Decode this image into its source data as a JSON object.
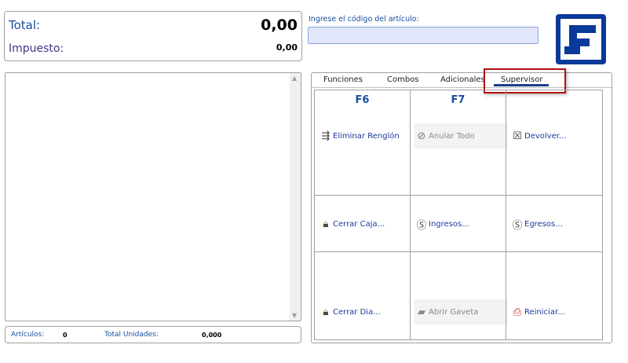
{
  "totals": {
    "total_label": "Total:",
    "total_value": "0,00",
    "tax_label": "Impuesto:",
    "tax_value": "0,00"
  },
  "footer": {
    "articles_label": "Artículos:",
    "articles_value": "0",
    "units_label": "Total Unidades:",
    "units_value": "0,000"
  },
  "code_input": {
    "label": "Ingrese el código del artículo:",
    "value": ""
  },
  "tabs": [
    {
      "label": "Funciones"
    },
    {
      "label": "Combos"
    },
    {
      "label": "Adicionales"
    },
    {
      "label": "Supervisor",
      "active": true
    }
  ],
  "shortcuts": [
    "F6",
    "F7"
  ],
  "actions": [
    {
      "label": "Eliminar Renglón",
      "icon": "delete-row-icon",
      "enabled": true
    },
    {
      "label": "Anular Todo",
      "icon": "void-all-icon",
      "enabled": false
    },
    {
      "label": "Devolver...",
      "icon": "return-icon",
      "enabled": true
    },
    {
      "label": "Cerrar Caja...",
      "icon": "lock-icon",
      "enabled": true
    },
    {
      "label": "Ingresos...",
      "icon": "dollar-icon",
      "enabled": true
    },
    {
      "label": "Egresos...",
      "icon": "dollar-icon",
      "enabled": true
    },
    {
      "label": "Cerrar Dia...",
      "icon": "lock-icon",
      "enabled": true
    },
    {
      "label": "Abrir Gaveta",
      "icon": "cash-drawer-icon",
      "enabled": false
    },
    {
      "label": "Reiniciar...",
      "icon": "printer-reset-icon",
      "enabled": true
    }
  ]
}
